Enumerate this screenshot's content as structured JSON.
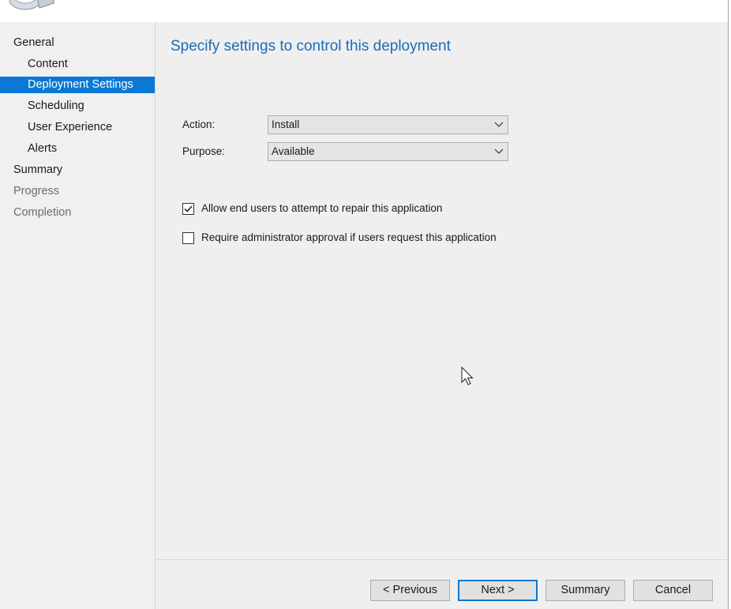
{
  "nav": {
    "items": [
      {
        "label": "General",
        "level": 0,
        "state": "normal"
      },
      {
        "label": "Content",
        "level": 1,
        "state": "normal"
      },
      {
        "label": "Deployment Settings",
        "level": 1,
        "state": "selected"
      },
      {
        "label": "Scheduling",
        "level": 1,
        "state": "normal"
      },
      {
        "label": "User Experience",
        "level": 1,
        "state": "normal"
      },
      {
        "label": "Alerts",
        "level": 1,
        "state": "normal"
      },
      {
        "label": "Summary",
        "level": 0,
        "state": "normal"
      },
      {
        "label": "Progress",
        "level": 0,
        "state": "disabled"
      },
      {
        "label": "Completion",
        "level": 0,
        "state": "disabled"
      }
    ]
  },
  "main": {
    "title": "Specify settings to control this deployment",
    "action": {
      "label": "Action:",
      "value": "Install"
    },
    "purpose": {
      "label": "Purpose:",
      "value": "Available"
    },
    "checkboxes": [
      {
        "label": "Allow end users to attempt to repair this application",
        "checked": true
      },
      {
        "label": "Require administrator approval if users request this application",
        "checked": false
      }
    ]
  },
  "buttons": {
    "previous": "< Previous",
    "next": "Next >",
    "summary": "Summary",
    "cancel": "Cancel"
  },
  "colors": {
    "accent": "#0a78d4",
    "title": "#1c6bb8",
    "background": "#f0f0f0"
  },
  "icons": {
    "banner": "computer-logo-icon",
    "combo_arrow": "chevron-down-icon",
    "check": "checkmark-icon",
    "cursor": "mouse-pointer-icon"
  }
}
